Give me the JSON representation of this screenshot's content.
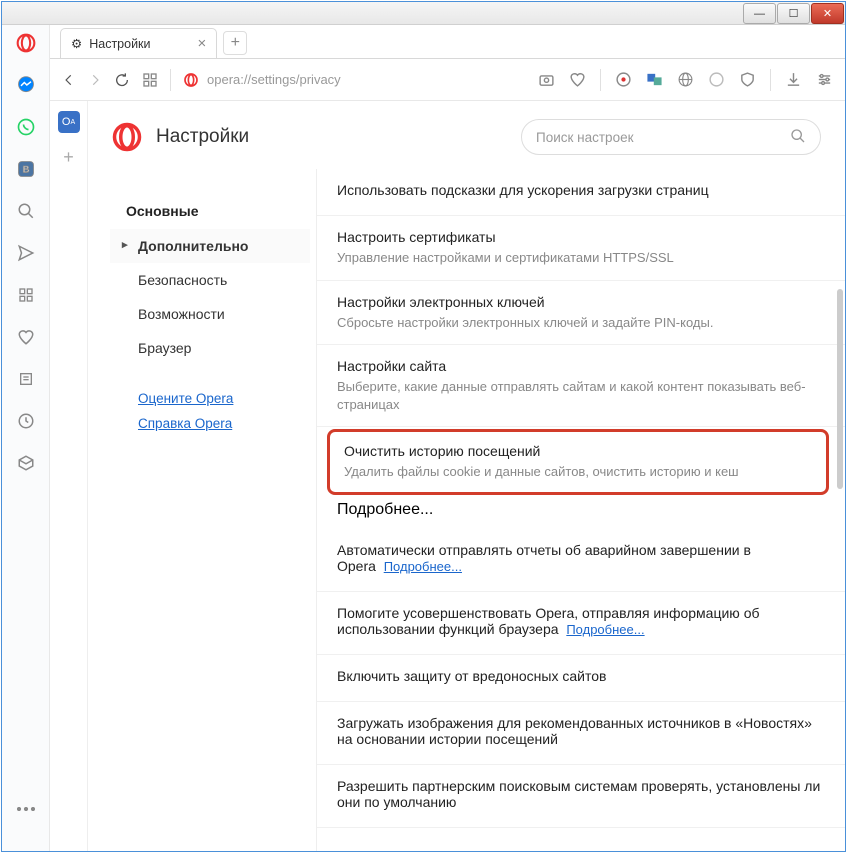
{
  "tab_title": "Настройки",
  "url": "opera://settings/privacy",
  "settings_title": "Настройки",
  "search_placeholder": "Поиск настроек",
  "nav": {
    "basic": "Основные",
    "advanced": "Дополнительно",
    "security": "Безопасность",
    "features": "Возможности",
    "browser": "Браузер"
  },
  "links": {
    "rate": "Оцените Opera",
    "help": "Справка Opera"
  },
  "opts": [
    {
      "t": "Использовать подсказки для ускорения загрузки страниц",
      "d": ""
    },
    {
      "t": "Настроить сертификаты",
      "d": "Управление настройками и сертификатами HTTPS/SSL"
    },
    {
      "t": "Настройки электронных ключей",
      "d": "Сбросьте настройки электронных ключей и задайте PIN-коды."
    },
    {
      "t": "Настройки сайта",
      "d": "Выберите, какие данные отправлять сайтам и какой контент показывать веб-страницах"
    },
    {
      "t": "Очистить историю посещений",
      "d": "Удалить файлы cookie и данные сайтов, очистить историю и кеш"
    }
  ],
  "more": "Подробнее...",
  "extra": [
    "Автоматически отправлять отчеты об аварийном завершении в Opera",
    "Помогите усовершенствовать Opera, отправляя информацию об использовании функций браузера",
    "Включить защиту от вредоносных сайтов",
    "Загружать изображения для рекомендованных источников в «Новостях» на основании истории посещений",
    "Разрешить партнерским поисковым системам проверять, установлены ли они по умолчанию"
  ]
}
